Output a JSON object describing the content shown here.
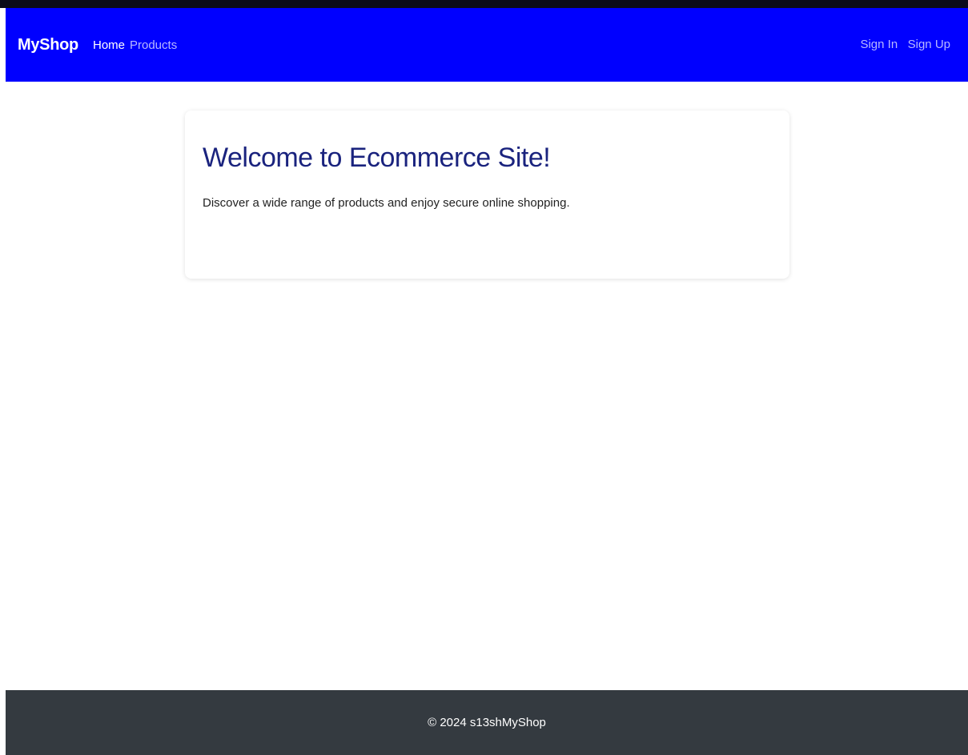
{
  "navbar": {
    "brand": "MyShop",
    "links": {
      "home": "Home",
      "products": "Products"
    },
    "auth": {
      "sign_in": "Sign In",
      "sign_up": "Sign Up"
    },
    "background_color": "#0000ff"
  },
  "hero": {
    "title": "Welcome to Ecommerce Site!",
    "text": "Discover a wide range of products and enjoy secure online shopping."
  },
  "footer": {
    "text": "© 2024 s13shMyShop",
    "background_color": "#343a40"
  }
}
